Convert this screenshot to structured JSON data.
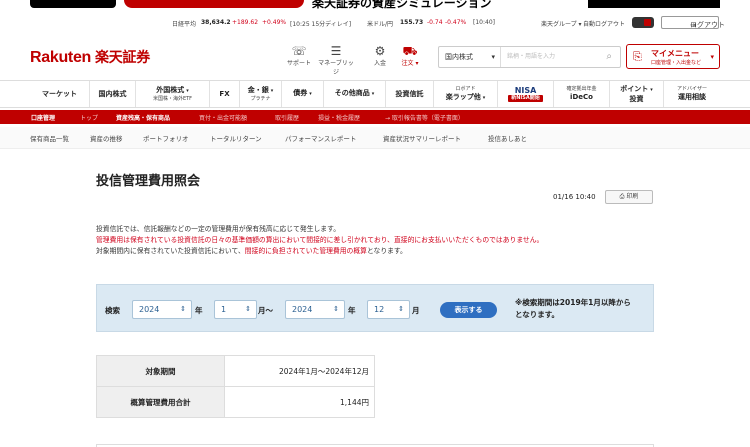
{
  "banner": {
    "partial_text": "楽天証券の資産シミュレーション"
  },
  "ticker": {
    "nikkei_label": "日経平均",
    "nikkei_value": "38,634.2",
    "nikkei_change": "+189.62",
    "nikkei_pct": "+0.49%",
    "nikkei_time": "[10:25 15分ディレイ]",
    "usdjpy_label": "米ドル/円",
    "usdjpy_value": "155.73",
    "usdjpy_change": "-0.74",
    "usdjpy_pct": "-0.47%",
    "usdjpy_time": "[10:40]",
    "group_label": "楽天グループ ▾",
    "auto_logout": "自動ログアウト",
    "logout_label": "ログアウト"
  },
  "header": {
    "logo_en": "Rakuten",
    "logo_jp": "楽天証券",
    "icons": [
      {
        "name": "support-icon",
        "glyph": "☏",
        "label": "サポート"
      },
      {
        "name": "money-bridge-icon",
        "glyph": "☰",
        "label": "マネーブリッジ"
      },
      {
        "name": "deposit-icon",
        "glyph": "⚙",
        "label": "入金"
      },
      {
        "name": "order-icon",
        "glyph": "⛟",
        "label": "注文 ▾"
      }
    ],
    "search_category": "国内株式",
    "search_placeholder": "銘柄・用語を入力",
    "mymenu_title": "マイメニュー",
    "mymenu_sub": "口座管理・入出金など"
  },
  "gnav": [
    {
      "label": "マーケット",
      "sub": ""
    },
    {
      "label": "国内株式",
      "sub": ""
    },
    {
      "label": "外国株式",
      "sub": "米国株・海外ETF"
    },
    {
      "label": "FX",
      "sub": ""
    },
    {
      "label": "金・銀",
      "sub": "プラチナ"
    },
    {
      "label": "債券",
      "sub": ""
    },
    {
      "label": "その他商品",
      "sub": ""
    },
    {
      "label": "投資信託",
      "sub": ""
    },
    {
      "label": "ロボアド",
      "sub": "楽ラップ他"
    },
    {
      "label": "NISA",
      "sub": "新NISA開始"
    },
    {
      "label": "確定拠出年金",
      "sub": "iDeCo"
    },
    {
      "label": "ポイント",
      "sub": "投資"
    },
    {
      "label": "アドバイザー",
      "sub": "運用相談"
    }
  ],
  "rnav": {
    "account": "口座管理",
    "top": "トップ",
    "holdings": "資産残高・保有商品",
    "withdraw": "買付・出金可能額",
    "history": "取引履歴",
    "tax": "損益・税金履歴",
    "report": "→ 取引報告書等（電子書面）"
  },
  "tnav": [
    "保有商品一覧",
    "資産の推移",
    "ポートフォリオ",
    "トータルリターン",
    "パフォーマンスレポート",
    "資産状況サマリーレポート",
    "投信あしあと"
  ],
  "page": {
    "title": "投信管理費用照会",
    "date": "01/16 10:40",
    "print_label": "印刷",
    "desc1": "投資信託では、信託報酬などの一定の管理費用が保有残高に応じて発生します。",
    "desc2": "管理費用は保有されている投資信託の日々の基準価額の算出において間接的に差し引かれており、直接的にお支払いいただくものではありません。",
    "desc3a": "対象期間内に保有されていた投資信託において、",
    "desc3b": "間接的に負担されていた管理費用の概算",
    "desc3c": "となります。"
  },
  "filter": {
    "search_label": "検索",
    "from_year": "2024",
    "year_unit": "年",
    "from_month": "1",
    "month_unit": "月～",
    "to_year": "2024",
    "to_month": "12",
    "month_unit2": "月",
    "show_button": "表示する",
    "note_line1": "※検索期間は2019年1月以降から",
    "note_line2": "となります。"
  },
  "summary": {
    "period_label": "対象期間",
    "period_value": "2024年1月～2024年12月",
    "total_label": "概算管理費用合計",
    "total_value": "1,144円"
  },
  "colors": {
    "brand_red": "#bf0000",
    "button_blue": "#2f6fc1",
    "filter_bg": "#dbe9f3"
  }
}
